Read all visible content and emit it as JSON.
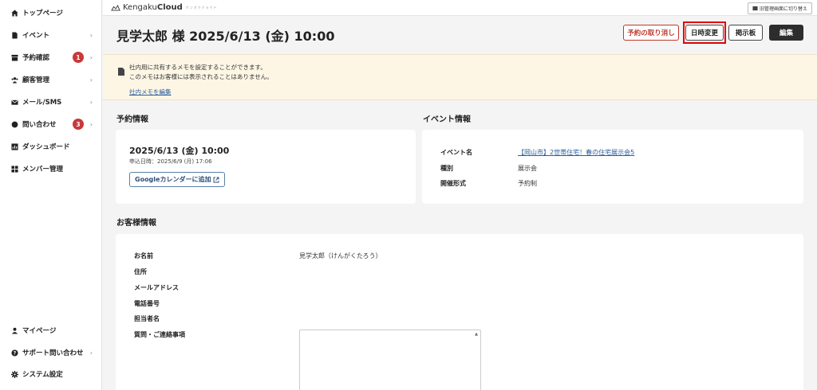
{
  "sidebar": {
    "items": [
      {
        "label": "トップページ",
        "icon": "home-icon"
      },
      {
        "label": "イベント",
        "icon": "document-icon",
        "chevron": "›"
      },
      {
        "label": "予約確認",
        "icon": "box-icon",
        "badge": "1",
        "chevron": "›"
      },
      {
        "label": "顧客管理",
        "icon": "users-icon",
        "chevron": "›"
      },
      {
        "label": "メール/SMS",
        "icon": "mail-icon",
        "chevron": "›"
      },
      {
        "label": "問い合わせ",
        "icon": "chat-icon",
        "badge": "3",
        "chevron": "›"
      },
      {
        "label": "ダッシュボード",
        "icon": "chart-icon"
      },
      {
        "label": "メンバー管理",
        "icon": "grid-icon"
      }
    ],
    "bottom_items": [
      {
        "label": "マイページ",
        "icon": "user-icon"
      },
      {
        "label": "サポート問い合わせ",
        "icon": "help-icon",
        "chevron": "›"
      },
      {
        "label": "システム設定",
        "icon": "gear-icon"
      }
    ]
  },
  "topbar": {
    "logo_light": "Kengaku",
    "logo_bold": "Cloud",
    "logo_sub": "ケンガククラウド",
    "switch_label": "旧管理画面に切り替え"
  },
  "header": {
    "title": "見学太郎 様 2025/6/13 (金) 10:00",
    "cancel_label": "予約の取り消し",
    "date_change_label": "日時変更",
    "board_label": "掲示板",
    "edit_label": "編集"
  },
  "memo": {
    "line1": "社内用に共有するメモを設定することができます。",
    "line2": "このメモはお客様には表示されることはありません。",
    "link": "社内メモを編集"
  },
  "reservation": {
    "section_title": "予約情報",
    "date": "2025/6/13 (金) 10:00",
    "applied": "申込日時：2025/6/9 (月) 17:06",
    "gcal_label": "Googleカレンダーに追加"
  },
  "event": {
    "section_title": "イベント情報",
    "rows": [
      {
        "label": "イベント名",
        "value": "【岡山市】2世帯住宅！春の住宅展示会5"
      },
      {
        "label": "種別",
        "value": "展示会"
      },
      {
        "label": "開催形式",
        "value": "予約制"
      }
    ]
  },
  "customer": {
    "section_title": "お客様情報",
    "rows": [
      {
        "label": "お名前",
        "value": "見学太郎（けんがくたろう）"
      },
      {
        "label": "住所",
        "value": ""
      },
      {
        "label": "メールアドレス",
        "value": ""
      },
      {
        "label": "電話番号",
        "value": ""
      },
      {
        "label": "担当者名",
        "value": ""
      },
      {
        "label": "質問・ご連絡事項",
        "value": ""
      }
    ]
  },
  "colors": {
    "accent_red": "#c0392b",
    "highlight": "#e30000",
    "link": "#2b5d9e",
    "memo_bg": "#fdf6e5"
  }
}
